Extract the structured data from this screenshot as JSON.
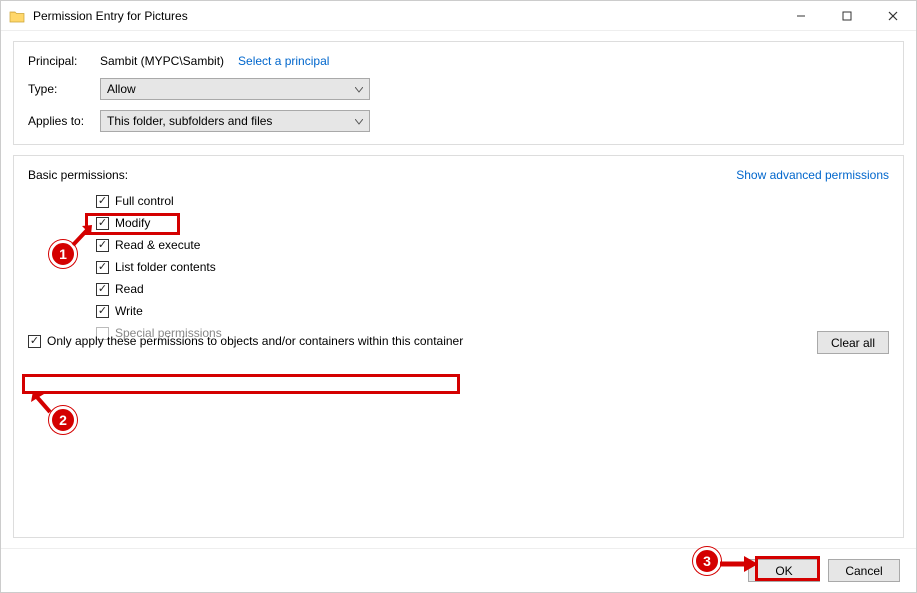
{
  "titlebar": {
    "title": "Permission Entry for Pictures"
  },
  "principal": {
    "label": "Principal:",
    "value": "Sambit (MYPC\\Sambit)",
    "select_link": "Select a principal"
  },
  "type": {
    "label": "Type:",
    "value": "Allow"
  },
  "applies": {
    "label": "Applies to:",
    "value": "This folder, subfolders and files"
  },
  "perm": {
    "heading": "Basic permissions:",
    "advanced_link": "Show advanced permissions",
    "items": {
      "full": "Full control",
      "modify": "Modify",
      "readexec": "Read & execute",
      "listfolder": "List folder contents",
      "read": "Read",
      "write": "Write",
      "special": "Special permissions"
    },
    "only_apply": "Only apply these permissions to objects and/or containers within this container",
    "clear_all": "Clear all"
  },
  "footer": {
    "ok": "OK",
    "cancel": "Cancel"
  },
  "annotations": {
    "b1": "1",
    "b2": "2",
    "b3": "3"
  }
}
